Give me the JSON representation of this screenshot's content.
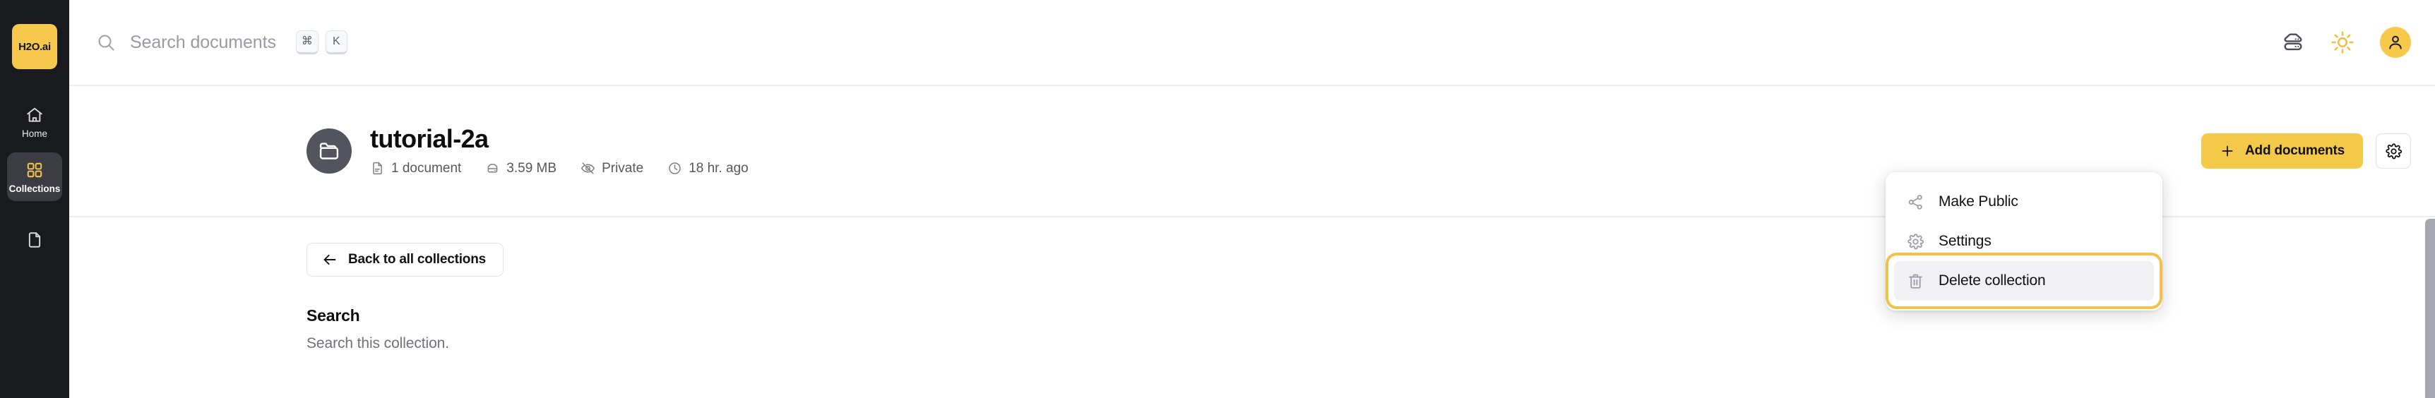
{
  "sidebar": {
    "logo_text": "H2O.ai",
    "items": [
      {
        "label": "Home",
        "icon": "home-icon",
        "active": false
      },
      {
        "label": "Collections",
        "icon": "grid-icon",
        "active": true
      },
      {
        "label": "",
        "icon": "document-icon",
        "active": false
      }
    ]
  },
  "topbar": {
    "search_placeholder": "Search documents",
    "kbd": [
      "⌘",
      "K"
    ],
    "icons": [
      "database-icon",
      "sun-icon",
      "user-avatar-icon"
    ]
  },
  "collection": {
    "title": "tutorial-2a",
    "avatar_icon": "folder-icon",
    "meta": [
      {
        "icon": "document-icon",
        "text": "1 document"
      },
      {
        "icon": "storage-icon",
        "text": "3.59 MB"
      },
      {
        "icon": "eye-off-icon",
        "text": "Private"
      },
      {
        "icon": "clock-icon",
        "text": "18 hr. ago"
      }
    ],
    "add_documents_label": "Add documents",
    "settings_icon": "gear-icon"
  },
  "menu": {
    "items": [
      {
        "label": "Make Public",
        "icon": "share-icon",
        "highlight": false
      },
      {
        "label": "Settings",
        "icon": "gear-icon",
        "highlight": false
      },
      {
        "label": "Delete collection",
        "icon": "trash-icon",
        "highlight": true
      }
    ]
  },
  "body": {
    "back_label": "Back to all collections",
    "section_title": "Search",
    "section_subtitle": "Search this collection."
  },
  "colors": {
    "brand_yellow": "#f5c948",
    "sidebar_bg": "#191a1d",
    "focus_ring": "#f0c24a",
    "avatar_gray": "#53545d"
  }
}
